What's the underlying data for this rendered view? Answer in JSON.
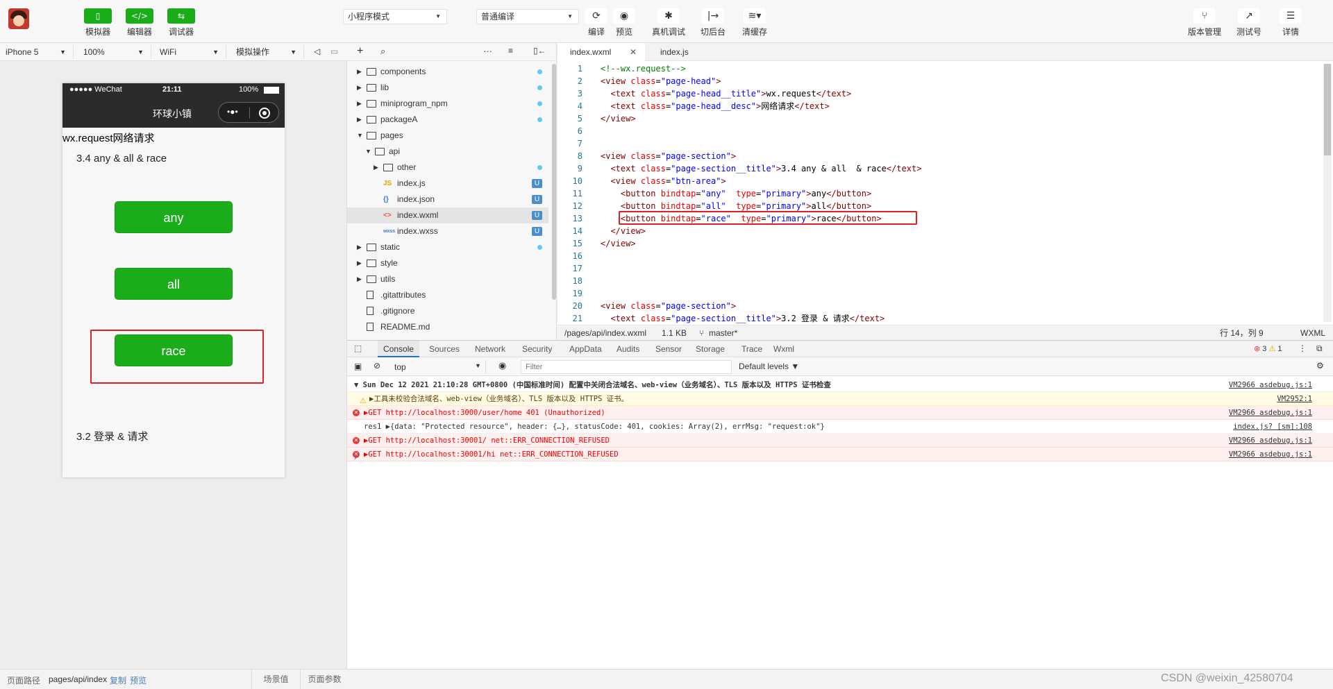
{
  "toolbar": {
    "simulator": "模拟器",
    "editor": "编辑器",
    "debugger": "调试器",
    "mode": "小程序模式",
    "compile_mode": "普通编译",
    "compile": "编译",
    "preview": "预览",
    "real_debug": "真机调试",
    "background": "切后台",
    "clear_cache": "清缓存",
    "version": "版本管理",
    "test_id": "测试号",
    "details": "详情"
  },
  "simbar": {
    "device": "iPhone 5",
    "zoom": "100%",
    "network": "WiFi",
    "operation": "模拟操作"
  },
  "phone": {
    "signal": "●●●●● WeChat",
    "time": "21:11",
    "battery": "100%",
    "nav_title": "环球小镇",
    "page_title": "wx.request网络请求",
    "section_title": "3.4 any & all & race",
    "btn_any": "any",
    "btn_all": "all",
    "btn_race": "race",
    "section2_title": "3.2 登录 & 请求"
  },
  "filetree": {
    "items": [
      {
        "name": "components",
        "type": "folder",
        "dot": true
      },
      {
        "name": "lib",
        "type": "folder",
        "dot": true
      },
      {
        "name": "miniprogram_npm",
        "type": "folder",
        "dot": true
      },
      {
        "name": "packageA",
        "type": "folder",
        "dot": true
      },
      {
        "name": "pages",
        "type": "folder-open"
      },
      {
        "name": "api",
        "type": "folder-open"
      },
      {
        "name": "other",
        "type": "folder",
        "dot": true
      },
      {
        "name": "index.js",
        "type": "file",
        "badge": "U",
        "icon": "JS"
      },
      {
        "name": "index.json",
        "type": "file",
        "badge": "U",
        "icon": "{}"
      },
      {
        "name": "index.wxml",
        "type": "file",
        "badge": "U",
        "icon": "<>"
      },
      {
        "name": "index.wxss",
        "type": "file",
        "badge": "U",
        "icon": "wxss"
      },
      {
        "name": "static",
        "type": "folder",
        "dot": true
      },
      {
        "name": "style",
        "type": "folder"
      },
      {
        "name": "utils",
        "type": "folder"
      },
      {
        "name": ".gitattributes",
        "type": "file"
      },
      {
        "name": ".gitignore",
        "type": "file"
      },
      {
        "name": "README.md",
        "type": "file"
      }
    ]
  },
  "editor": {
    "tab1": "index.wxml",
    "tab2": "index.js",
    "path": "/pages/api/index.wxml",
    "size": "1.1 KB",
    "branch": "master*",
    "position": "行 14，列 9",
    "lang": "WXML",
    "lines": [
      {
        "n": "1",
        "html": "<span class=\"cmt\">&lt;!--wx.request--&gt;</span>"
      },
      {
        "n": "2",
        "html": "<span class=\"tag\">&lt;view</span> <span class=\"att\">class</span>=<span class=\"str\">\"page-head\"</span><span class=\"tag\">&gt;</span>"
      },
      {
        "n": "3",
        "html": "  <span class=\"tag\">&lt;text</span> <span class=\"att\">class</span>=<span class=\"str\">\"page-head__title\"</span><span class=\"tag\">&gt;</span>wx.request<span class=\"tag\">&lt;/text&gt;</span>"
      },
      {
        "n": "4",
        "html": "  <span class=\"tag\">&lt;text</span> <span class=\"att\">class</span>=<span class=\"str\">\"page-head__desc\"</span><span class=\"tag\">&gt;</span>网络请求<span class=\"tag\">&lt;/text&gt;</span>"
      },
      {
        "n": "5",
        "html": "<span class=\"tag\">&lt;/view&gt;</span>"
      },
      {
        "n": "6",
        "html": ""
      },
      {
        "n": "7",
        "html": ""
      },
      {
        "n": "8",
        "html": "<span class=\"tag\">&lt;view</span> <span class=\"att\">class</span>=<span class=\"str\">\"page-section\"</span><span class=\"tag\">&gt;</span>"
      },
      {
        "n": "9",
        "html": "  <span class=\"tag\">&lt;text</span> <span class=\"att\">class</span>=<span class=\"str\">\"page-section__title\"</span><span class=\"tag\">&gt;</span>3.4 any &amp; all  &amp; race<span class=\"tag\">&lt;/text&gt;</span>"
      },
      {
        "n": "10",
        "html": "  <span class=\"tag\">&lt;view</span> <span class=\"att\">class</span>=<span class=\"str\">\"btn-area\"</span><span class=\"tag\">&gt;</span>"
      },
      {
        "n": "11",
        "html": "    <span class=\"tag\">&lt;button</span> <span class=\"att\">bindtap</span>=<span class=\"str\">\"any\"</span>  <span class=\"att\">type</span>=<span class=\"str\">\"primary\"</span><span class=\"tag\">&gt;</span>any<span class=\"tag\">&lt;/button&gt;</span>"
      },
      {
        "n": "12",
        "html": "    <span class=\"tag\">&lt;button</span> <span class=\"att\">bindtap</span>=<span class=\"str\">\"all\"</span>  <span class=\"att\">type</span>=<span class=\"str\">\"primary\"</span><span class=\"tag\">&gt;</span>all<span class=\"tag\">&lt;/button&gt;</span>"
      },
      {
        "n": "13",
        "html": "    <span class=\"tag\">&lt;button</span> <span class=\"att\">bindtap</span>=<span class=\"str\">\"race\"</span>  <span class=\"att\">type</span>=<span class=\"str\">\"primary\"</span><span class=\"tag\">&gt;</span>race<span class=\"tag\">&lt;/button&gt;</span>"
      },
      {
        "n": "14",
        "html": "  <span class=\"tag\">&lt;/view&gt;</span>"
      },
      {
        "n": "15",
        "html": "<span class=\"tag\">&lt;/view&gt;</span>"
      },
      {
        "n": "16",
        "html": ""
      },
      {
        "n": "17",
        "html": ""
      },
      {
        "n": "18",
        "html": ""
      },
      {
        "n": "19",
        "html": ""
      },
      {
        "n": "20",
        "html": "<span class=\"tag\">&lt;view</span> <span class=\"att\">class</span>=<span class=\"str\">\"page-section\"</span><span class=\"tag\">&gt;</span>"
      },
      {
        "n": "21",
        "html": "  <span class=\"tag\">&lt;text</span> <span class=\"att\">class</span>=<span class=\"str\">\"page-section__title\"</span><span class=\"tag\">&gt;</span>3.2 登录 &amp; 请求<span class=\"tag\">&lt;/text&gt;</span>"
      }
    ]
  },
  "devtools": {
    "tabs": [
      "Console",
      "Sources",
      "Network",
      "Security",
      "AppData",
      "Audits",
      "Sensor",
      "Storage",
      "Trace",
      "Wxml"
    ],
    "context": "top",
    "filter_placeholder": "Filter",
    "levels": "Default levels ▼",
    "err_count": "3",
    "warn_count": "1",
    "messages": [
      {
        "kind": "group",
        "text": "▼ Sun Dec 12 2021 21:10:28 GMT+0800 (中国标准时间) 配置中关闭合法域名、web-view（业务域名）、TLS 版本以及 HTTPS 证书检查",
        "src": "VM2966 asdebug.js:1"
      },
      {
        "kind": "warn",
        "text": "▶工具未校验合法域名、web-view（业务域名）、TLS 版本以及 HTTPS 证书。",
        "src": "VM2952:1"
      },
      {
        "kind": "err",
        "text": "▶GET http://localhost:3000/user/home 401 (Unauthorized)",
        "src": "VM2966 asdebug.js:1"
      },
      {
        "kind": "log",
        "text": "res1 ▶{data: \"Protected resource\", header: {…}, statusCode: 401, cookies: Array(2), errMsg: \"request:ok\"}",
        "src": "index.js? [sm]:108"
      },
      {
        "kind": "err",
        "text": "▶GET http://localhost:30001/ net::ERR_CONNECTION_REFUSED",
        "src": "VM2966 asdebug.js:1"
      },
      {
        "kind": "err",
        "text": "▶GET http://localhost:30001/hi net::ERR_CONNECTION_REFUSED",
        "src": "VM2966 asdebug.js:1"
      }
    ]
  },
  "statusbar": {
    "path_label": "页面路径",
    "path": "pages/api/index",
    "copy": "复制",
    "preview": "预览",
    "scene": "场景值",
    "params": "页面参数"
  },
  "watermark": "CSDN @weixin_42580704"
}
